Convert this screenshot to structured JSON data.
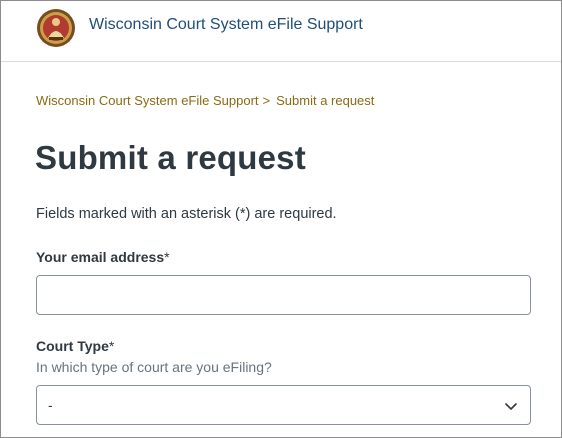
{
  "header": {
    "logo_icon": "court-seal-icon",
    "site_title": "Wisconsin Court System eFile Support"
  },
  "breadcrumb": {
    "home": "Wisconsin Court System eFile Support",
    "separator": ">",
    "current": "Submit a request"
  },
  "page": {
    "title": "Submit a request",
    "required_note": "Fields marked with an asterisk (*) are required."
  },
  "form": {
    "email": {
      "label": "Your email address",
      "asterisk": "*",
      "value": ""
    },
    "court_type": {
      "label": "Court Type",
      "asterisk": "*",
      "hint": "In which type of court are you eFiling?",
      "selected": "-",
      "icon": "chevron-down-icon"
    }
  },
  "colors": {
    "breadcrumb": "#8a6a12",
    "site_title": "#1f4e79",
    "text": "#2f3941"
  }
}
